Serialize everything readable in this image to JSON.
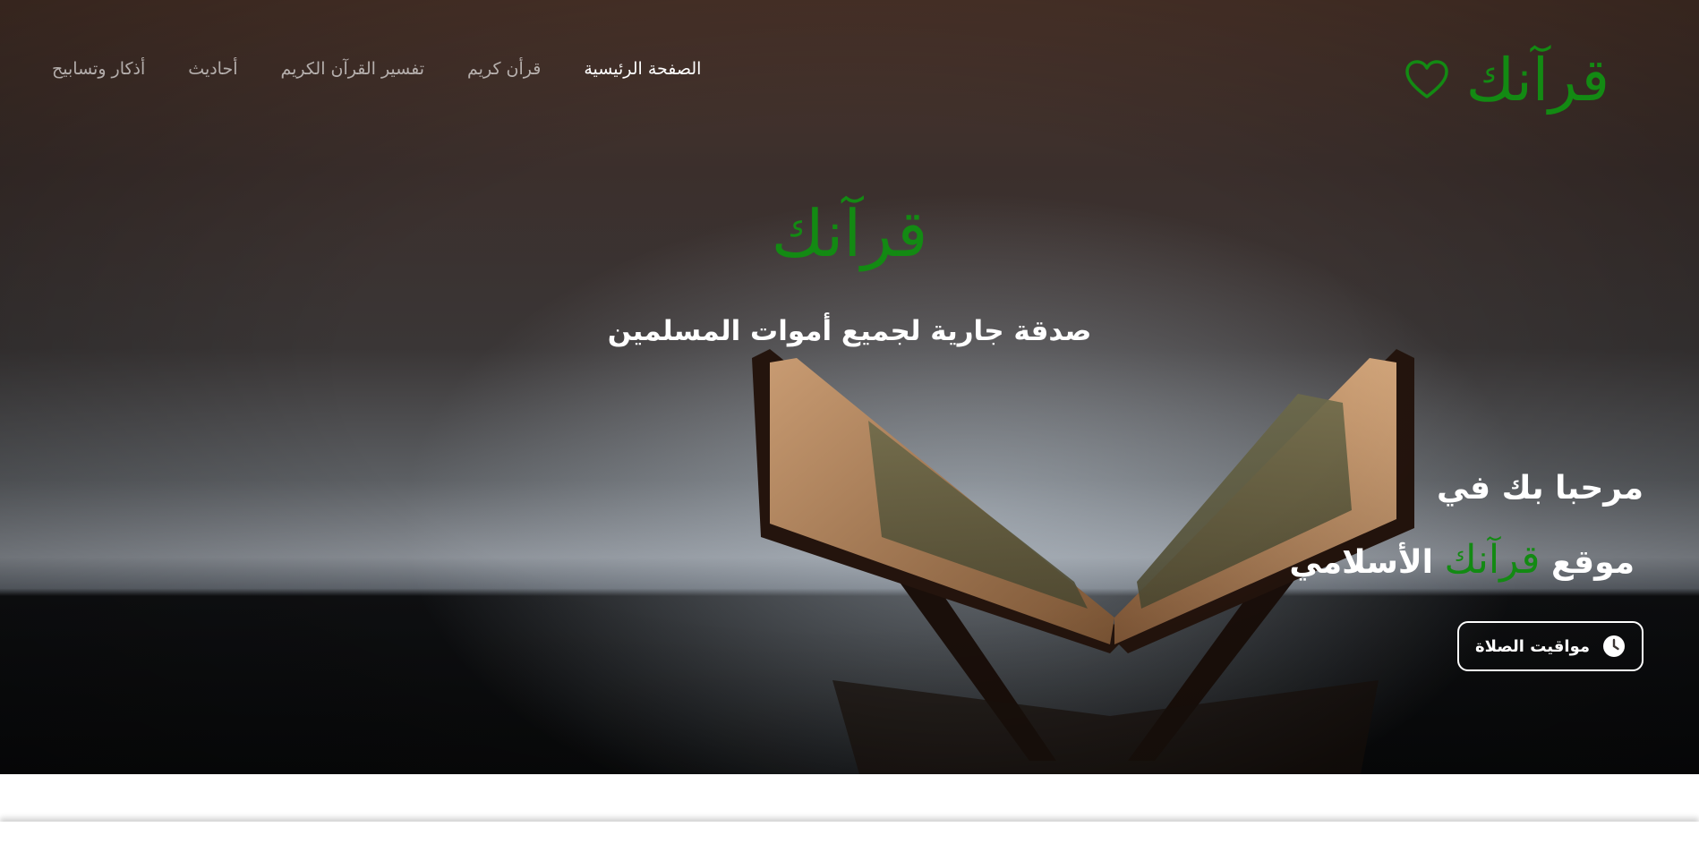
{
  "brand": {
    "logo_text": "قرآنك",
    "center_title": "قرآنك",
    "logo_icon": "heart-outline-icon",
    "accent_color": "#138a13"
  },
  "nav": {
    "items": [
      {
        "label": "أذكار وتسابيح"
      },
      {
        "label": "أحاديث"
      },
      {
        "label": "تفسير القرآن الكريم"
      },
      {
        "label": "قرأن كريم"
      },
      {
        "label": "الصفحة الرئيسية",
        "active": true
      }
    ]
  },
  "hero": {
    "tagline": "صدقة جارية لجميع أموات المسلمين",
    "welcome_line1": "مرحبا بك في",
    "welcome_line2_prefix": "موقع",
    "welcome_line2_brand": "قرآنك",
    "welcome_line2_suffix": "الأسلامي",
    "prayer_button": {
      "label": "مواقيت الصلاة",
      "icon": "clock-icon"
    }
  }
}
